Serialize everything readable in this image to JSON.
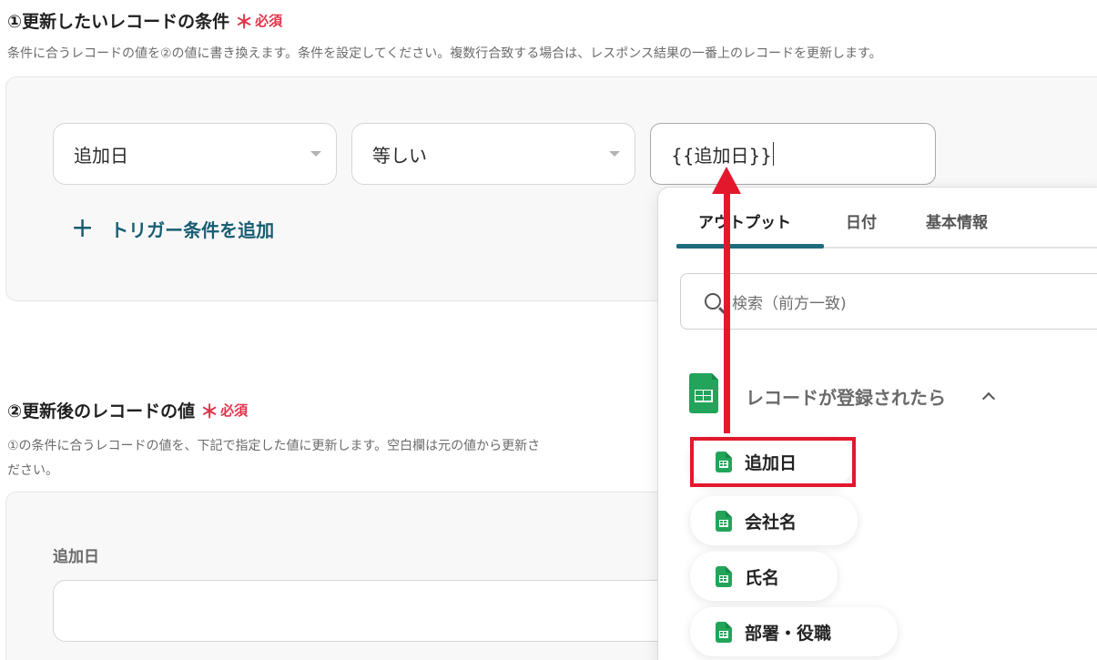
{
  "condition_section": {
    "title": "①更新したいレコードの条件",
    "required_star": "＊",
    "required_label": "必須",
    "description": "条件に合うレコードの値を②の値に書き換えます。条件を設定してください。複数行合致する場合は、レスポンス結果の一番上のレコードを更新します。",
    "field_select": "追加日",
    "operator_select": "等しい",
    "value_input": "{{追加日}}",
    "add_condition_label": "トリガー条件を追加"
  },
  "picker": {
    "tabs": [
      {
        "label": "アウトプット",
        "active": true
      },
      {
        "label": "日付",
        "active": false
      },
      {
        "label": "基本情報",
        "active": false
      }
    ],
    "search_placeholder": "検索（前方一致)",
    "group_label": "レコードが登録されたら",
    "items": [
      {
        "label": "追加日",
        "highlighted": true
      },
      {
        "label": "会社名"
      },
      {
        "label": "氏名"
      },
      {
        "label": "部署・役職"
      }
    ]
  },
  "value_section": {
    "title": "②更新後のレコードの値",
    "required_star": "＊",
    "required_label": "必須",
    "description_line1": "①の条件に合うレコードの値を、下記で指定した値に更新します。空白欄は元の値から更新さ",
    "description_line2": "ださい。",
    "field_label": "追加日"
  },
  "colors": {
    "accent_teal": "#1d6b7d",
    "required_red": "#e0344a",
    "annotation_red": "#e3182d",
    "sheets_green": "#22a45a"
  }
}
